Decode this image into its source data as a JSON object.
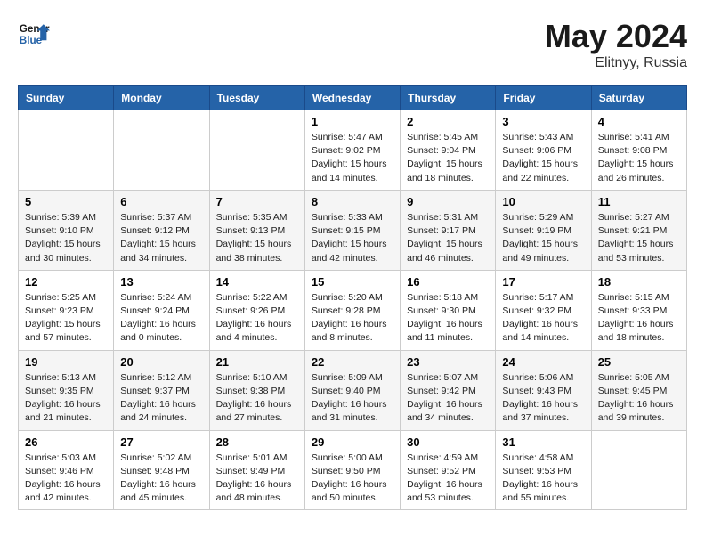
{
  "header": {
    "logo_line1": "General",
    "logo_line2": "Blue",
    "month_year": "May 2024",
    "location": "Elitnyy, Russia"
  },
  "weekdays": [
    "Sunday",
    "Monday",
    "Tuesday",
    "Wednesday",
    "Thursday",
    "Friday",
    "Saturday"
  ],
  "weeks": [
    [
      {
        "day": "",
        "info": ""
      },
      {
        "day": "",
        "info": ""
      },
      {
        "day": "",
        "info": ""
      },
      {
        "day": "1",
        "info": "Sunrise: 5:47 AM\nSunset: 9:02 PM\nDaylight: 15 hours\nand 14 minutes."
      },
      {
        "day": "2",
        "info": "Sunrise: 5:45 AM\nSunset: 9:04 PM\nDaylight: 15 hours\nand 18 minutes."
      },
      {
        "day": "3",
        "info": "Sunrise: 5:43 AM\nSunset: 9:06 PM\nDaylight: 15 hours\nand 22 minutes."
      },
      {
        "day": "4",
        "info": "Sunrise: 5:41 AM\nSunset: 9:08 PM\nDaylight: 15 hours\nand 26 minutes."
      }
    ],
    [
      {
        "day": "5",
        "info": "Sunrise: 5:39 AM\nSunset: 9:10 PM\nDaylight: 15 hours\nand 30 minutes."
      },
      {
        "day": "6",
        "info": "Sunrise: 5:37 AM\nSunset: 9:12 PM\nDaylight: 15 hours\nand 34 minutes."
      },
      {
        "day": "7",
        "info": "Sunrise: 5:35 AM\nSunset: 9:13 PM\nDaylight: 15 hours\nand 38 minutes."
      },
      {
        "day": "8",
        "info": "Sunrise: 5:33 AM\nSunset: 9:15 PM\nDaylight: 15 hours\nand 42 minutes."
      },
      {
        "day": "9",
        "info": "Sunrise: 5:31 AM\nSunset: 9:17 PM\nDaylight: 15 hours\nand 46 minutes."
      },
      {
        "day": "10",
        "info": "Sunrise: 5:29 AM\nSunset: 9:19 PM\nDaylight: 15 hours\nand 49 minutes."
      },
      {
        "day": "11",
        "info": "Sunrise: 5:27 AM\nSunset: 9:21 PM\nDaylight: 15 hours\nand 53 minutes."
      }
    ],
    [
      {
        "day": "12",
        "info": "Sunrise: 5:25 AM\nSunset: 9:23 PM\nDaylight: 15 hours\nand 57 minutes."
      },
      {
        "day": "13",
        "info": "Sunrise: 5:24 AM\nSunset: 9:24 PM\nDaylight: 16 hours\nand 0 minutes."
      },
      {
        "day": "14",
        "info": "Sunrise: 5:22 AM\nSunset: 9:26 PM\nDaylight: 16 hours\nand 4 minutes."
      },
      {
        "day": "15",
        "info": "Sunrise: 5:20 AM\nSunset: 9:28 PM\nDaylight: 16 hours\nand 8 minutes."
      },
      {
        "day": "16",
        "info": "Sunrise: 5:18 AM\nSunset: 9:30 PM\nDaylight: 16 hours\nand 11 minutes."
      },
      {
        "day": "17",
        "info": "Sunrise: 5:17 AM\nSunset: 9:32 PM\nDaylight: 16 hours\nand 14 minutes."
      },
      {
        "day": "18",
        "info": "Sunrise: 5:15 AM\nSunset: 9:33 PM\nDaylight: 16 hours\nand 18 minutes."
      }
    ],
    [
      {
        "day": "19",
        "info": "Sunrise: 5:13 AM\nSunset: 9:35 PM\nDaylight: 16 hours\nand 21 minutes."
      },
      {
        "day": "20",
        "info": "Sunrise: 5:12 AM\nSunset: 9:37 PM\nDaylight: 16 hours\nand 24 minutes."
      },
      {
        "day": "21",
        "info": "Sunrise: 5:10 AM\nSunset: 9:38 PM\nDaylight: 16 hours\nand 27 minutes."
      },
      {
        "day": "22",
        "info": "Sunrise: 5:09 AM\nSunset: 9:40 PM\nDaylight: 16 hours\nand 31 minutes."
      },
      {
        "day": "23",
        "info": "Sunrise: 5:07 AM\nSunset: 9:42 PM\nDaylight: 16 hours\nand 34 minutes."
      },
      {
        "day": "24",
        "info": "Sunrise: 5:06 AM\nSunset: 9:43 PM\nDaylight: 16 hours\nand 37 minutes."
      },
      {
        "day": "25",
        "info": "Sunrise: 5:05 AM\nSunset: 9:45 PM\nDaylight: 16 hours\nand 39 minutes."
      }
    ],
    [
      {
        "day": "26",
        "info": "Sunrise: 5:03 AM\nSunset: 9:46 PM\nDaylight: 16 hours\nand 42 minutes."
      },
      {
        "day": "27",
        "info": "Sunrise: 5:02 AM\nSunset: 9:48 PM\nDaylight: 16 hours\nand 45 minutes."
      },
      {
        "day": "28",
        "info": "Sunrise: 5:01 AM\nSunset: 9:49 PM\nDaylight: 16 hours\nand 48 minutes."
      },
      {
        "day": "29",
        "info": "Sunrise: 5:00 AM\nSunset: 9:50 PM\nDaylight: 16 hours\nand 50 minutes."
      },
      {
        "day": "30",
        "info": "Sunrise: 4:59 AM\nSunset: 9:52 PM\nDaylight: 16 hours\nand 53 minutes."
      },
      {
        "day": "31",
        "info": "Sunrise: 4:58 AM\nSunset: 9:53 PM\nDaylight: 16 hours\nand 55 minutes."
      },
      {
        "day": "",
        "info": ""
      }
    ]
  ]
}
